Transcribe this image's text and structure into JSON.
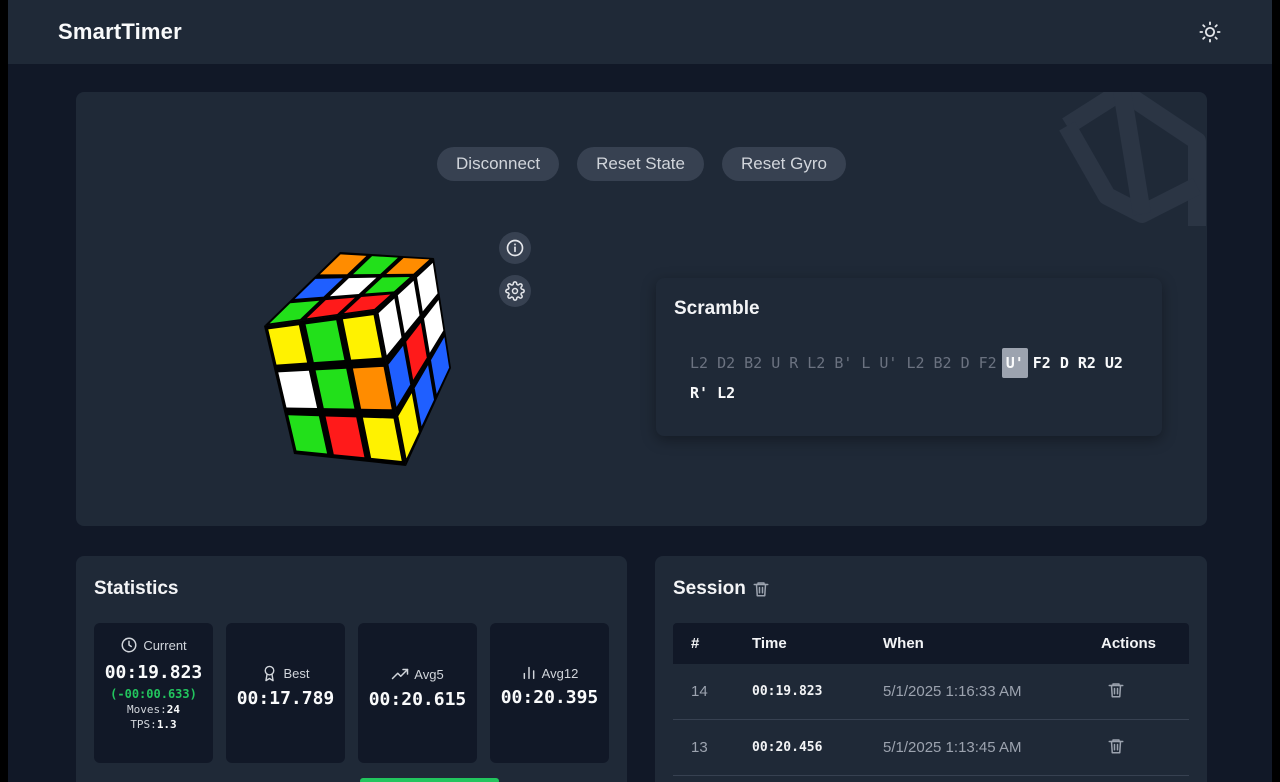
{
  "header": {
    "brand": "SmartTimer",
    "theme_icon": "sun-icon"
  },
  "controls": {
    "disconnect": "Disconnect",
    "reset_state": "Reset State",
    "reset_gyro": "Reset Gyro"
  },
  "cube": {
    "top": [
      [
        "orange",
        "green",
        "orange"
      ],
      [
        "blue",
        "white",
        "green"
      ],
      [
        "green",
        "red",
        "red"
      ]
    ],
    "front": [
      [
        "yellow",
        "green",
        "yellow"
      ],
      [
        "white",
        "green",
        "orange"
      ],
      [
        "green",
        "red",
        "yellow"
      ]
    ],
    "right": [
      [
        "white",
        "white",
        "white"
      ],
      [
        "blue",
        "red",
        "white"
      ],
      [
        "yellow",
        "blue",
        "blue"
      ]
    ]
  },
  "scramble": {
    "title": "Scramble",
    "moves": [
      {
        "m": "L2",
        "s": "done"
      },
      {
        "m": "D2",
        "s": "done"
      },
      {
        "m": "B2",
        "s": "done"
      },
      {
        "m": "U",
        "s": "done"
      },
      {
        "m": "R",
        "s": "done"
      },
      {
        "m": "L2",
        "s": "done"
      },
      {
        "m": "B'",
        "s": "done"
      },
      {
        "m": "L",
        "s": "done"
      },
      {
        "m": "U'",
        "s": "done"
      },
      {
        "m": "L2",
        "s": "done"
      },
      {
        "m": "B2",
        "s": "done"
      },
      {
        "m": "D",
        "s": "done"
      },
      {
        "m": "F2",
        "s": "done"
      },
      {
        "m": "U'",
        "s": "current"
      },
      {
        "m": "F2",
        "s": "todo"
      },
      {
        "m": "D",
        "s": "todo"
      },
      {
        "m": "R2",
        "s": "todo"
      },
      {
        "m": "U2",
        "s": "todo"
      },
      {
        "m": "R'",
        "s": "todo"
      },
      {
        "m": "L2",
        "s": "todo"
      }
    ]
  },
  "statistics": {
    "title": "Statistics",
    "current": {
      "label": "Current",
      "value": "00:19.823",
      "diff": "(-00:00.633)",
      "moves_label": "Moves:",
      "moves": "24",
      "tps_label": "TPS:",
      "tps": "1.3"
    },
    "best": {
      "label": "Best",
      "value": "00:17.789"
    },
    "avg5": {
      "label": "Avg5",
      "value": "00:20.615"
    },
    "avg12": {
      "label": "Avg12",
      "value": "00:20.395"
    }
  },
  "session": {
    "title": "Session",
    "columns": [
      "#",
      "Time",
      "When",
      "Actions"
    ],
    "rows": [
      {
        "num": "14",
        "time": "00:19.823",
        "when": "5/1/2025 1:16:33 AM"
      },
      {
        "num": "13",
        "time": "00:20.456",
        "when": "5/1/2025 1:13:45 AM"
      }
    ]
  },
  "colors": {
    "orange": "#ff8c00",
    "green": "#22e01a",
    "blue": "#1f5fff",
    "white": "#ffffff",
    "red": "#ff1a1a",
    "yellow": "#fff200",
    "accent_green": "#22c55e"
  }
}
